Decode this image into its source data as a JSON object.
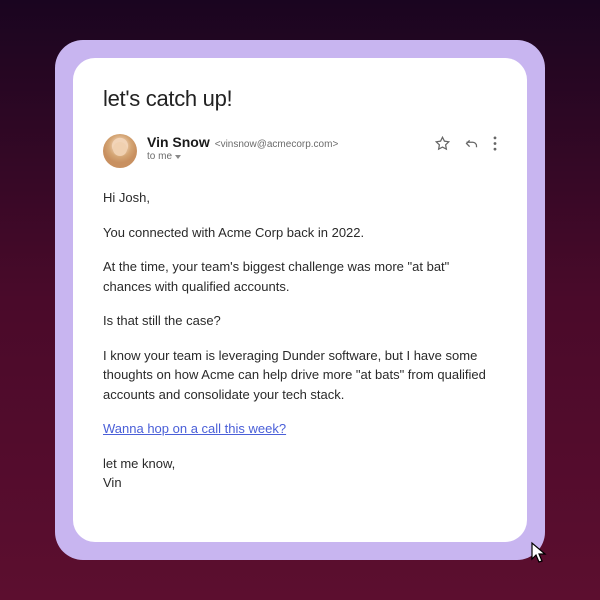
{
  "email": {
    "subject": "let's catch up!",
    "sender": {
      "name": "Vin Snow",
      "address": "<vinsnow@acmecorp.com>",
      "to_label": "to me"
    },
    "body": {
      "greeting": "Hi Josh,",
      "p1": "You connected with Acme Corp back in 2022.",
      "p2": "At the time, your team's biggest challenge was more \"at bat\" chances with qualified accounts.",
      "p3": "Is that still the case?",
      "p4": "I know your team is leveraging Dunder software, but I have some thoughts on how Acme can help drive more \"at bats\" from qualified accounts and consolidate your tech stack.",
      "cta": "Wanna hop on a call this week?",
      "signoff": "let me know,",
      "signature": "Vin"
    }
  },
  "icons": {
    "star": "star-icon",
    "reply": "reply-icon",
    "more": "more-icon",
    "dropdown": "chevron-down-icon"
  }
}
